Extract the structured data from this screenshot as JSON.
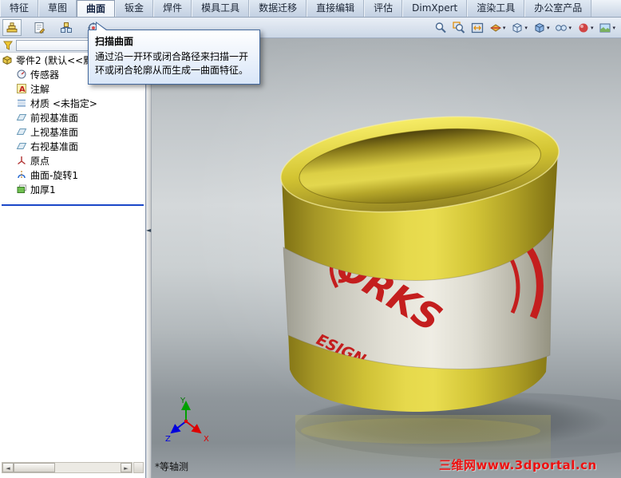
{
  "ribbon_tabs": [
    {
      "name": "features",
      "label": "特征",
      "active": false
    },
    {
      "name": "sketch",
      "label": "草图",
      "active": false
    },
    {
      "name": "surfaces",
      "label": "曲面",
      "active": true
    },
    {
      "name": "sheet-metal",
      "label": "钣金",
      "active": false
    },
    {
      "name": "weldments",
      "label": "焊件",
      "active": false
    },
    {
      "name": "mold-tools",
      "label": "模具工具",
      "active": false
    },
    {
      "name": "data-migration",
      "label": "数据迁移",
      "active": false
    },
    {
      "name": "direct-editing",
      "label": "直接编辑",
      "active": false
    },
    {
      "name": "evaluate",
      "label": "评估",
      "active": false
    },
    {
      "name": "dimxpert",
      "label": "DimXpert",
      "active": false
    },
    {
      "name": "render-tools",
      "label": "渲染工具",
      "active": false
    },
    {
      "name": "office-products",
      "label": "办公室产品",
      "active": false
    }
  ],
  "panel_tabs": [
    {
      "name": "featuremanager-tab",
      "icon": "featuremanager"
    },
    {
      "name": "propertymanager-tab",
      "icon": "propertymanager"
    },
    {
      "name": "configurationmanager-tab",
      "icon": "configurationmanager"
    },
    {
      "name": "dimxpertmanager-tab",
      "icon": "dimxpertmanager"
    }
  ],
  "view_toolbar": [
    {
      "name": "zoom-in-out-button",
      "icon": "magnifier",
      "caret": false
    },
    {
      "name": "zoom-to-area-button",
      "icon": "magnifier-area",
      "caret": false
    },
    {
      "name": "zoom-to-fit-button",
      "icon": "magnifier-fit",
      "caret": false
    },
    {
      "name": "section-view-button",
      "icon": "section",
      "caret": true
    },
    {
      "name": "view-orientation-button",
      "icon": "orientation",
      "caret": true
    },
    {
      "name": "display-style-button",
      "icon": "display-style",
      "caret": true
    },
    {
      "name": "hide-show-items-button",
      "icon": "hide-show",
      "caret": true
    },
    {
      "name": "edit-appearance-button",
      "icon": "appearance",
      "caret": true
    },
    {
      "name": "apply-scene-button",
      "icon": "scene",
      "caret": true
    }
  ],
  "tooltip": {
    "title": "扫描曲面",
    "body": "通过沿一开环或闭合路径来扫描一开环或闭合轮廓从而生成一曲面特征。"
  },
  "feature_tree": {
    "root_label": "零件2 (默认<<默认>_显示状态",
    "items": [
      {
        "name": "tree-item-sensors",
        "label": "传感器",
        "icon": "sensors"
      },
      {
        "name": "tree-item-annotations",
        "label": "注解",
        "icon": "annotations"
      },
      {
        "name": "tree-item-material",
        "label": "材质 <未指定>",
        "icon": "material"
      },
      {
        "name": "tree-item-front-plane",
        "label": "前视基准面",
        "icon": "plane"
      },
      {
        "name": "tree-item-top-plane",
        "label": "上视基准面",
        "icon": "plane"
      },
      {
        "name": "tree-item-right-plane",
        "label": "右视基准面",
        "icon": "plane"
      },
      {
        "name": "tree-item-origin",
        "label": "原点",
        "icon": "origin"
      },
      {
        "name": "tree-item-surface-revolve1",
        "label": "曲面-旋转1",
        "icon": "surface-revolve"
      },
      {
        "name": "tree-item-thicken1",
        "label": "加厚1",
        "icon": "thicken"
      }
    ]
  },
  "viewport": {
    "view_label": "*等轴测",
    "watermark": "三维网www.3dportal.cn",
    "triad": {
      "x": "X",
      "y": "Y",
      "z": "Z"
    },
    "model_text": {
      "line1": "ORKS",
      "line2": "ESIGN"
    }
  },
  "glyphs": {
    "caret": "▾",
    "collapse_left": "◄",
    "scroll_left": "◄",
    "scroll_right": "►"
  },
  "colors": {
    "mug_yellow": "#d8ca35",
    "band_gray": "#e6e4da",
    "logo_red": "#c41e1e",
    "watermark_red": "#ee1010",
    "rollback_blue": "#1a47c8",
    "toolbar_blue": "#cbd7e6",
    "viewport_gray": "#b4babd"
  }
}
